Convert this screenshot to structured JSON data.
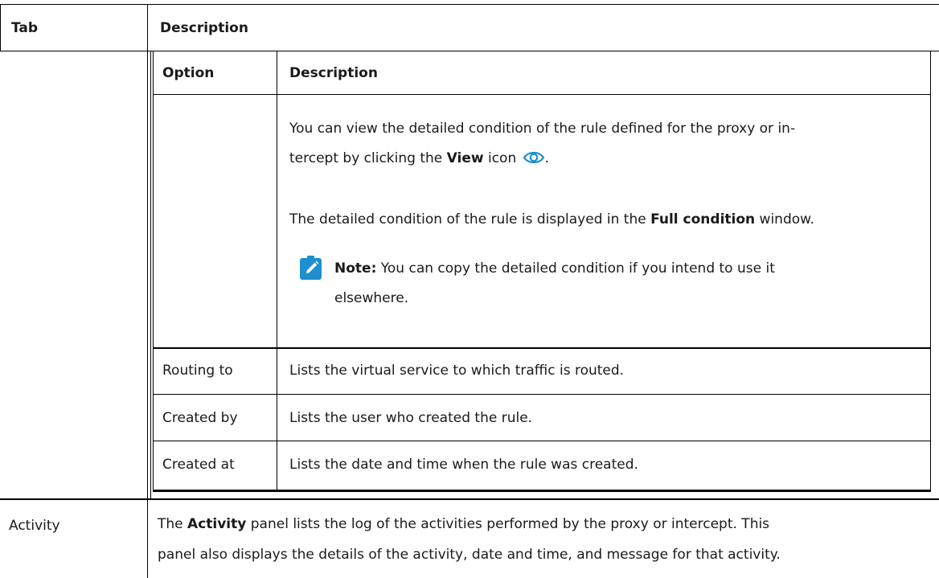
{
  "outer": {
    "header_tab": "Tab",
    "header_description": "Description",
    "activity_label": "Activity",
    "activity_text": {
      "before": "The ",
      "bold": "Activity",
      "after_line1": " panel lists the log of the activities performed by the proxy or intercept. This",
      "line2": "panel also displays the details of the activity, date and time, and message for that activity."
    }
  },
  "inner": {
    "header_option": "Option",
    "header_description": "Description",
    "view_para": {
      "line1": "You can view the detailed condition of the rule defined for the proxy or in-",
      "line2_before": "tercept by clicking the ",
      "line2_bold": "View",
      "line2_after": " icon",
      "line2_end": "."
    },
    "condition_para": {
      "before": "The detailed condition of the rule is displayed in the ",
      "bold": "Full condition",
      "after": " window."
    },
    "note": {
      "label": "Note:",
      "line1": " You can copy the detailed condition if you intend to use it",
      "line2": "elsewhere."
    },
    "rows": [
      {
        "option": "Routing to",
        "description": "Lists the virtual service to which traffic is routed."
      },
      {
        "option": "Created by",
        "description": "Lists the user who created the rule."
      },
      {
        "option": "Created at",
        "description": "Lists the date and time when the rule was created."
      }
    ]
  },
  "icons": {
    "view": "eye-icon",
    "note": "pencil-note-icon"
  },
  "colors": {
    "note_icon": "#1f8fcf",
    "view_icon": "#1f8fcf"
  }
}
